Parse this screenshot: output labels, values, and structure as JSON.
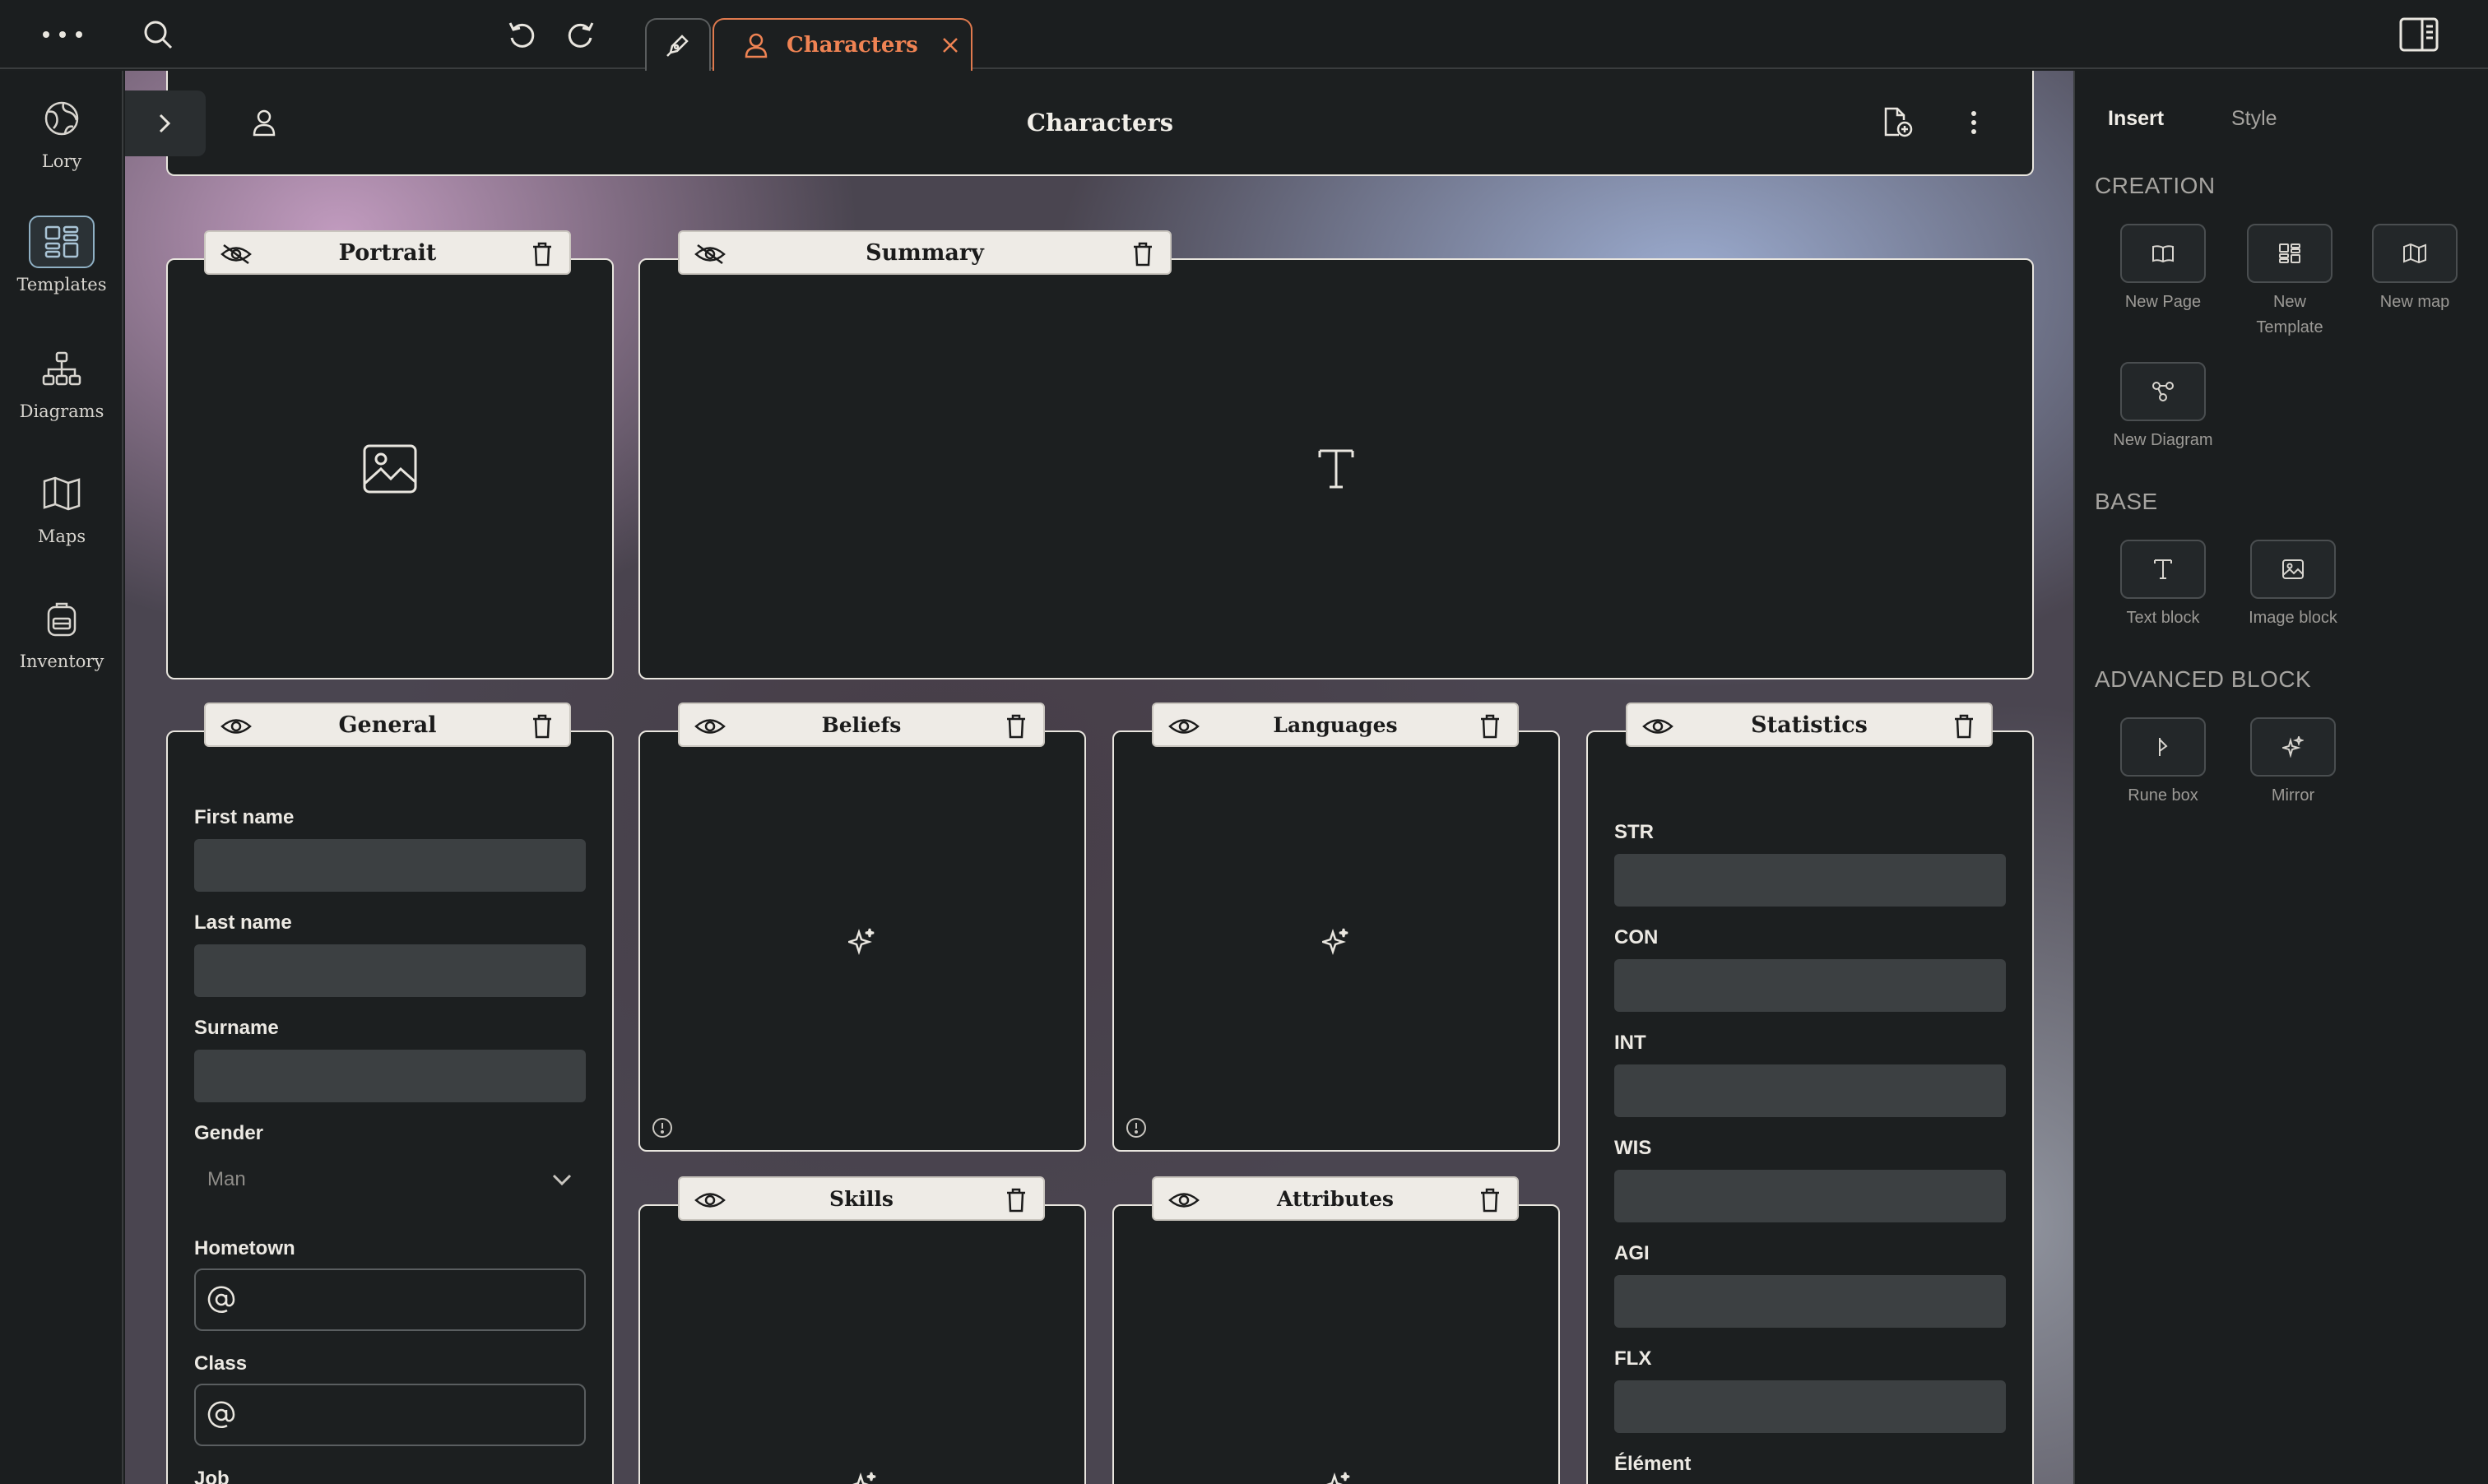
{
  "topbar": {
    "tab_title": "Characters"
  },
  "sidebar": {
    "items": [
      {
        "label": "Lory",
        "icon": "globe-icon"
      },
      {
        "label": "Templates",
        "icon": "templates-icon"
      },
      {
        "label": "Diagrams",
        "icon": "diagram-icon"
      },
      {
        "label": "Maps",
        "icon": "map-icon"
      },
      {
        "label": "Inventory",
        "icon": "backpack-icon"
      }
    ]
  },
  "header": {
    "title": "Characters"
  },
  "blocks": {
    "portrait": "Portrait",
    "summary": "Summary",
    "general": "General",
    "beliefs": "Beliefs",
    "languages": "Languages",
    "statistics": "Statistics",
    "skills": "Skills",
    "attributes": "Attributes"
  },
  "general": {
    "first_name": "First name",
    "last_name": "Last name",
    "surname": "Surname",
    "gender": "Gender",
    "gender_value": "Man",
    "hometown": "Hometown",
    "class": "Class",
    "job": "Job"
  },
  "statistics": {
    "str": "STR",
    "con": "CON",
    "int": "INT",
    "wis": "WIS",
    "agi": "AGI",
    "flx": "FLX",
    "element": "Élément"
  },
  "right_panel": {
    "tabs": {
      "insert": "Insert",
      "style": "Style"
    },
    "creation": "CREATION",
    "new_page": "New Page",
    "new_template_1": "New",
    "new_template_2": "Template",
    "new_map": "New map",
    "new_diagram": "New Diagram",
    "base": "BASE",
    "text_block": "Text block",
    "image_block": "Image block",
    "advanced": "ADVANCED BLOCK",
    "rune_box": "Rune box",
    "mirror": "Mirror"
  },
  "colors": {
    "accent": "#ef8353",
    "panel": "#1c1f20",
    "label_bg": "#eeebe6"
  }
}
